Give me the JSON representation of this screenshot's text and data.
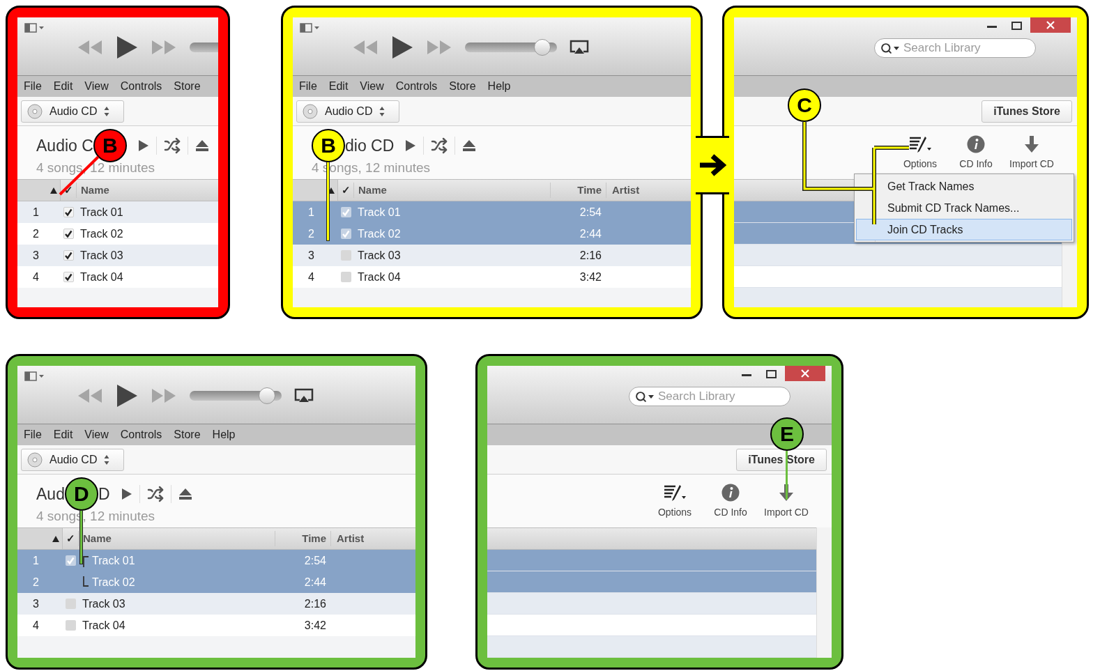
{
  "panels": [
    {
      "kind": "library",
      "color": "#ff0000",
      "callout": "B",
      "menu": [
        "File",
        "Edit",
        "View",
        "Controls",
        "Store"
      ],
      "source": "Audio CD",
      "title_before": "Audio C",
      "summary": "4 songs, 12 minutes",
      "columns": [
        "✓",
        "Name"
      ],
      "rows": [
        {
          "number": "1",
          "name": "Track 01",
          "checked": true,
          "selected": false
        },
        {
          "number": "2",
          "name": "Track 02",
          "checked": true,
          "selected": false
        },
        {
          "number": "3",
          "name": "Track 03",
          "checked": true,
          "selected": false
        },
        {
          "number": "4",
          "name": "Track 04",
          "checked": true,
          "selected": false
        }
      ]
    },
    {
      "kind": "library",
      "color": "#ffff00",
      "callout": "B",
      "volume": {
        "level": 0.92
      },
      "airplay": true,
      "menu": [
        "File",
        "Edit",
        "View",
        "Controls",
        "Store",
        "Help"
      ],
      "source": "Audio CD",
      "title_after": "dio CD",
      "summary": "4 songs, 12 minutes",
      "columns": [
        "✓",
        "Name",
        "Time",
        "Artist"
      ],
      "rows": [
        {
          "number": "1",
          "name": "Track 01",
          "time": "2:54",
          "checked": true,
          "selected": true
        },
        {
          "number": "2",
          "name": "Track 02",
          "time": "2:44",
          "checked": true,
          "selected": true
        },
        {
          "number": "3",
          "name": "Track 03",
          "time": "2:16",
          "checked": false,
          "selected": false
        },
        {
          "number": "4",
          "name": "Track 04",
          "time": "3:42",
          "checked": false,
          "selected": false
        }
      ]
    },
    {
      "kind": "toolbar",
      "color": "#ffff00",
      "callout": "C",
      "search": {
        "placeholder": "Search Library"
      },
      "store_button": "iTunes Store",
      "tools": [
        {
          "kind": "options",
          "label": "Options"
        },
        {
          "kind": "info",
          "label": "CD Info"
        },
        {
          "kind": "import",
          "label": "Import CD"
        }
      ],
      "menu": [
        {
          "label": "Get Track Names",
          "selected": false
        },
        {
          "label": "Submit CD Track Names...",
          "selected": false
        },
        {
          "label": "Join CD Tracks",
          "selected": true
        }
      ],
      "rows": [
        {
          "selected": true
        },
        {
          "selected": true
        },
        {
          "selected": false
        },
        {
          "selected": false
        },
        {
          "selected": false
        }
      ]
    },
    {
      "kind": "library",
      "color": "#6cbf3f",
      "callout": "D",
      "volume": {
        "level": 0.92
      },
      "airplay": true,
      "menu": [
        "File",
        "Edit",
        "View",
        "Controls",
        "Store",
        "Help"
      ],
      "source": "Audio CD",
      "title_before": "Aud",
      "title_after": "D",
      "summary": "4 songs, 12 minutes",
      "columns": [
        "✓",
        "Name",
        "Time",
        "Artist"
      ],
      "rows": [
        {
          "kind": "join_first",
          "number": "1",
          "name": "Track 01",
          "time": "2:54",
          "checked": true,
          "selected": true
        },
        {
          "kind": "join_last",
          "number": "2",
          "name": "Track 02",
          "time": "2:44",
          "selected": true
        },
        {
          "kind": "track",
          "number": "3",
          "name": "Track 03",
          "time": "2:16",
          "checked": false,
          "selected": false
        },
        {
          "kind": "track",
          "number": "4",
          "name": "Track 04",
          "time": "3:42",
          "checked": false,
          "selected": false
        }
      ]
    },
    {
      "kind": "toolbar",
      "color": "#6cbf3f",
      "callout": "E",
      "search": {
        "placeholder": "Search Library"
      },
      "store_button": "iTunes Store",
      "tools": [
        {
          "kind": "options",
          "label": "Options"
        },
        {
          "kind": "info",
          "label": "CD Info"
        },
        {
          "kind": "import",
          "label": "Import CD"
        }
      ],
      "rows": [
        {
          "selected": true
        },
        {
          "selected": true
        },
        {
          "selected": false
        },
        {
          "selected": false
        },
        {
          "selected": false
        }
      ]
    }
  ]
}
